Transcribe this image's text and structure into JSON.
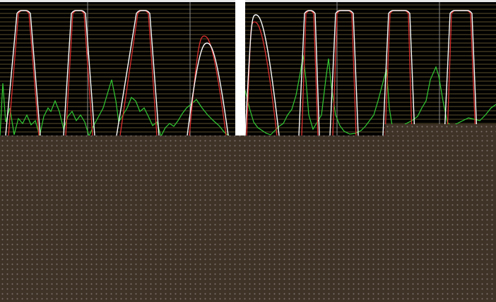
{
  "colors": {
    "background": "#000000",
    "grid_minor": "#7a6a3c",
    "grid_major": "#8c8c8c",
    "trace_white": "#ffffff",
    "trace_red": "#e03030",
    "trace_green": "#33cc33",
    "divider": "#ffffff",
    "floor": "#3f3227"
  },
  "panels": [
    {
      "id": "left",
      "major_gridlines_x": [
        124,
        269
      ],
      "white_peaks": [
        {
          "start": 8,
          "rise": 27,
          "fall": 40,
          "end": 57
        },
        {
          "start": 90,
          "rise": 104,
          "fall": 118,
          "end": 134
        },
        {
          "start": 165,
          "rise": 196,
          "fall": 209,
          "end": 225
        },
        {
          "start": 265,
          "rise": 293,
          "fall": 293,
          "end": 323,
          "peak": 58
        }
      ],
      "red_peaks": [
        {
          "start": 12,
          "rise": 29,
          "fall": 38,
          "end": 55
        },
        {
          "start": 93,
          "rise": 106,
          "fall": 116,
          "end": 131
        },
        {
          "start": 170,
          "rise": 198,
          "fall": 207,
          "end": 222
        },
        {
          "start": 268,
          "rise": 289,
          "fall": 289,
          "end": 320,
          "peak": 48
        }
      ],
      "green_trace": [
        [
          0,
          190
        ],
        [
          4,
          115
        ],
        [
          8,
          170
        ],
        [
          14,
          150
        ],
        [
          20,
          188
        ],
        [
          26,
          165
        ],
        [
          32,
          172
        ],
        [
          38,
          160
        ],
        [
          44,
          174
        ],
        [
          50,
          168
        ],
        [
          56,
          190
        ],
        [
          62,
          162
        ],
        [
          68,
          150
        ],
        [
          72,
          155
        ],
        [
          78,
          140
        ],
        [
          84,
          155
        ],
        [
          90,
          180
        ],
        [
          96,
          162
        ],
        [
          102,
          155
        ],
        [
          108,
          168
        ],
        [
          114,
          160
        ],
        [
          120,
          170
        ],
        [
          126,
          190
        ],
        [
          132,
          176
        ],
        [
          138,
          165
        ],
        [
          146,
          150
        ],
        [
          152,
          130
        ],
        [
          158,
          110
        ],
        [
          164,
          140
        ],
        [
          168,
          170
        ],
        [
          174,
          160
        ],
        [
          180,
          150
        ],
        [
          186,
          135
        ],
        [
          192,
          140
        ],
        [
          198,
          155
        ],
        [
          204,
          150
        ],
        [
          210,
          162
        ],
        [
          216,
          175
        ],
        [
          222,
          170
        ],
        [
          228,
          190
        ],
        [
          234,
          178
        ],
        [
          240,
          172
        ],
        [
          246,
          176
        ],
        [
          252,
          168
        ],
        [
          258,
          158
        ],
        [
          264,
          150
        ],
        [
          270,
          145
        ],
        [
          278,
          138
        ],
        [
          286,
          150
        ],
        [
          294,
          160
        ],
        [
          302,
          168
        ],
        [
          310,
          175
        ],
        [
          318,
          185
        ],
        [
          325,
          190
        ]
      ]
    },
    {
      "id": "right",
      "major_gridlines_x": [
        130,
        275
      ],
      "white_peaks": [
        {
          "start": 0,
          "rise": 15,
          "fall": 15,
          "end": 48,
          "peak": 18
        },
        {
          "start": 76,
          "rise": 87,
          "fall": 96,
          "end": 105
        },
        {
          "start": 120,
          "rise": 131,
          "fall": 150,
          "end": 160
        },
        {
          "start": 195,
          "rise": 206,
          "fall": 230,
          "end": 240
        },
        {
          "start": 282,
          "rise": 293,
          "fall": 318,
          "end": 328
        }
      ],
      "red_peaks": [
        {
          "start": 2,
          "rise": 13,
          "fall": 13,
          "end": 45,
          "peak": 28
        },
        {
          "start": 80,
          "rise": 89,
          "fall": 94,
          "end": 103
        },
        {
          "start": 124,
          "rise": 133,
          "fall": 148,
          "end": 157
        },
        {
          "start": 198,
          "rise": 208,
          "fall": 228,
          "end": 236
        },
        {
          "start": 286,
          "rise": 295,
          "fall": 316,
          "end": 326
        }
      ],
      "green_trace": [
        [
          0,
          125
        ],
        [
          6,
          150
        ],
        [
          12,
          170
        ],
        [
          18,
          178
        ],
        [
          24,
          182
        ],
        [
          30,
          186
        ],
        [
          36,
          188
        ],
        [
          42,
          182
        ],
        [
          48,
          176
        ],
        [
          54,
          172
        ],
        [
          60,
          160
        ],
        [
          66,
          152
        ],
        [
          72,
          132
        ],
        [
          78,
          100
        ],
        [
          82,
          75
        ],
        [
          86,
          110
        ],
        [
          90,
          160
        ],
        [
          96,
          180
        ],
        [
          102,
          170
        ],
        [
          108,
          160
        ],
        [
          114,
          110
        ],
        [
          118,
          80
        ],
        [
          122,
          120
        ],
        [
          128,
          160
        ],
        [
          134,
          175
        ],
        [
          140,
          183
        ],
        [
          148,
          187
        ],
        [
          156,
          186
        ],
        [
          164,
          182
        ],
        [
          170,
          176
        ],
        [
          176,
          168
        ],
        [
          182,
          160
        ],
        [
          188,
          140
        ],
        [
          196,
          110
        ],
        [
          200,
          95
        ],
        [
          204,
          150
        ],
        [
          208,
          175
        ],
        [
          216,
          178
        ],
        [
          222,
          176
        ],
        [
          228,
          172
        ],
        [
          236,
          168
        ],
        [
          244,
          162
        ],
        [
          250,
          150
        ],
        [
          256,
          140
        ],
        [
          262,
          110
        ],
        [
          270,
          92
        ],
        [
          274,
          105
        ],
        [
          280,
          140
        ],
        [
          286,
          170
        ],
        [
          292,
          176
        ],
        [
          300,
          172
        ],
        [
          308,
          168
        ],
        [
          316,
          164
        ],
        [
          324,
          166
        ],
        [
          332,
          168
        ],
        [
          340,
          160
        ],
        [
          348,
          150
        ],
        [
          355,
          145
        ]
      ]
    }
  ]
}
